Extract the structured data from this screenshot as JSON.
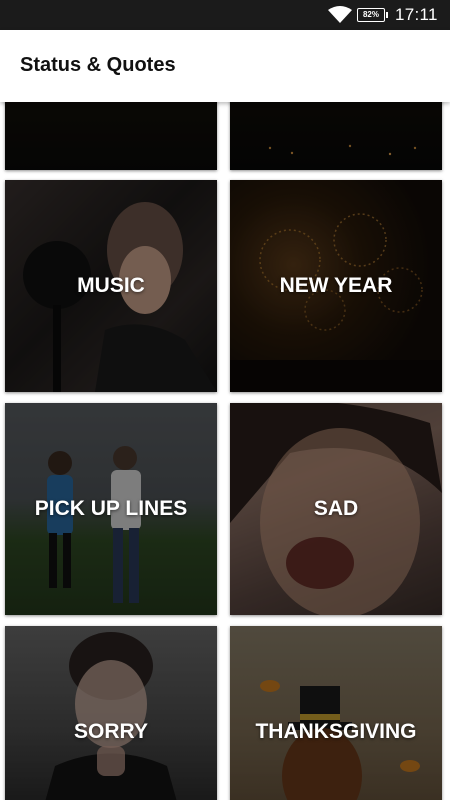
{
  "status_bar": {
    "battery": "82%",
    "time": "17:11"
  },
  "app_bar": {
    "title": "Status & Quotes"
  },
  "tiles": [
    {
      "label": "",
      "icon": "sunset-photo"
    },
    {
      "label": "",
      "icon": "city-night-photo"
    },
    {
      "label": "MUSIC",
      "icon": "singer-photo"
    },
    {
      "label": "NEW YEAR",
      "icon": "fireworks-photo"
    },
    {
      "label": "PICK UP LINES",
      "icon": "couple-photo"
    },
    {
      "label": "SAD",
      "icon": "crying-face-photo"
    },
    {
      "label": "SORRY",
      "icon": "apologizing-woman-photo"
    },
    {
      "label": "THANKSGIVING",
      "icon": "turkey-illustration"
    }
  ]
}
